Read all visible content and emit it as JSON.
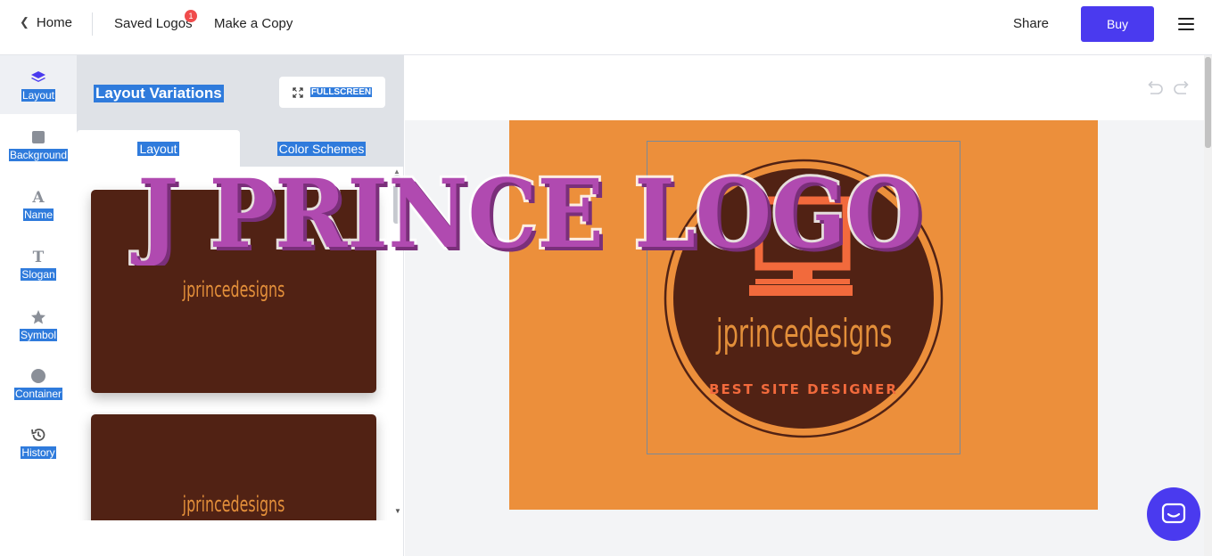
{
  "topbar": {
    "home_label": "Home",
    "saved_label": "Saved Logos",
    "saved_badge": "1",
    "copy_label": "Make a Copy",
    "share_label": "Share",
    "buy_label": "Buy",
    "buy_color": "#4a3aef",
    "icons": [
      "chevron-left-icon",
      "hamburger-menu-icon"
    ]
  },
  "rail": {
    "items": [
      {
        "label": "Layout",
        "icon": "layers-icon",
        "active": true
      },
      {
        "label": "Background",
        "icon": "square-icon"
      },
      {
        "label": "Name",
        "icon": "letter-a-icon"
      },
      {
        "label": "Slogan",
        "icon": "letter-t-icon"
      },
      {
        "label": "Symbol",
        "icon": "star-icon"
      },
      {
        "label": "Container",
        "icon": "circle-icon"
      },
      {
        "label": "History",
        "icon": "history-icon"
      }
    ]
  },
  "panel": {
    "title": "Layout Variations",
    "fullscreen_label": "FULLSCREEN",
    "tabs": [
      {
        "label": "Layout",
        "active": true
      },
      {
        "label": "Color Schemes"
      }
    ],
    "thumbnails": [
      {
        "text": "jprincedesigns",
        "bg": "#512214"
      },
      {
        "text": "jprincedesigns",
        "bg": "#512214"
      }
    ]
  },
  "logo": {
    "name": "jprincedesigns",
    "slogan": "BEST SITE DESIGNER",
    "background": "#ec8f3b",
    "container_color": "#512214",
    "text_color": "#e38f3a",
    "symbol_color": "#f26a3c",
    "symbol": "computer-monitor-icon"
  },
  "watermark": {
    "text": "J PRINCE LOGO",
    "color": "#b04ab0"
  },
  "chat": {
    "icon": "chat-icon",
    "color": "#4a3aef"
  }
}
